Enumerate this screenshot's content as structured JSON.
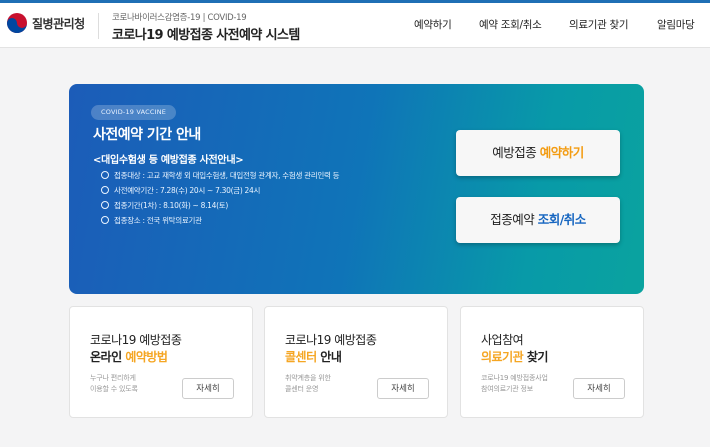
{
  "header": {
    "org_name": "질병관리청",
    "subtitle": "코로나바이러스감염증-19 | COVID-19",
    "title": "코로나19 예방접종 사전예약 시스템",
    "nav": [
      "예약하기",
      "예약 조회/취소",
      "의료기관 찾기",
      "알림마당"
    ]
  },
  "banner": {
    "badge": "COVID-19 VACCINE",
    "title": "사전예약 기간 안내",
    "notice_heading": "<대입수험생 등 예방접종 사전안내>",
    "items": [
      "접종대상 : 고교 재학생 외 대입수험생, 대입전형 관계자, 수험생 관리인력 등",
      "사전예약기간 : 7.28(수) 20시 ~ 7.30(금) 24시",
      "접종기간(1차) : 8.10(화) ~ 8.14(토)",
      "접종장소 : 전국 위탁의료기관"
    ],
    "reserve_button": {
      "prefix": "예방접종 ",
      "highlight": "예약하기"
    },
    "lookup_button": {
      "prefix": "접종예약 ",
      "highlight": "조회/취소"
    }
  },
  "cards": [
    {
      "line1": "코로나19 예방접종",
      "line2_prefix": "온라인 ",
      "line2_accent": "예약방법",
      "line2_suffix": "",
      "desc1": "누구나 편리하게",
      "desc2": "이용할 수 있도록",
      "button": "자세히"
    },
    {
      "line1": "코로나19 예방접종",
      "line2_prefix": "",
      "line2_accent": "콜센터",
      "line2_suffix": " 안내",
      "desc1": "취약계층을 위한",
      "desc2": "콜센터 운영",
      "button": "자세히"
    },
    {
      "line1": "사업참여",
      "line2_prefix": "",
      "line2_accent": "의료기관",
      "line2_suffix": " 찾기",
      "desc1": "코로나19 예방접종사업",
      "desc2": "참여의료기관 정보",
      "button": "자세히"
    }
  ],
  "colors": {
    "accent_yellow": "#f39c12",
    "accent_blue": "#1565c0",
    "banner_start": "#1c5cb8",
    "banner_end": "#0aa39f"
  }
}
